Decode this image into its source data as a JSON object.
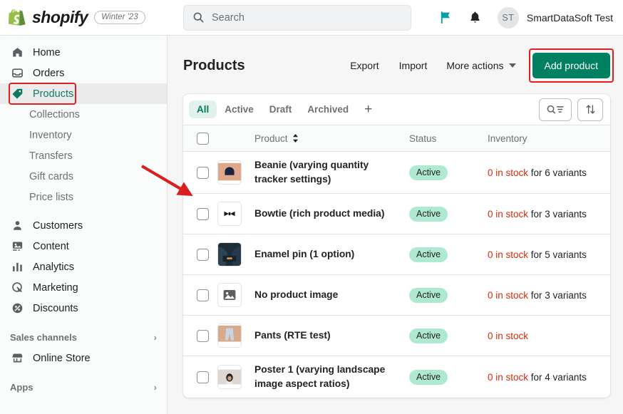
{
  "topbar": {
    "brand_name": "shopify",
    "version_badge": "Winter '23",
    "search_placeholder": "Search",
    "flag_icon": "flag-icon",
    "bell_icon": "bell-icon",
    "avatar_initials": "ST",
    "user_name": "SmartDataSoft Test",
    "accent_teal": "#008fa8"
  },
  "sidebar": {
    "primary": [
      {
        "label": "Home",
        "icon": "home-icon"
      },
      {
        "label": "Orders",
        "icon": "orders-icon"
      },
      {
        "label": "Products",
        "icon": "products-tag-icon",
        "active": true,
        "annotated": true
      }
    ],
    "product_sub": [
      {
        "label": "Collections"
      },
      {
        "label": "Inventory"
      },
      {
        "label": "Transfers"
      },
      {
        "label": "Gift cards"
      },
      {
        "label": "Price lists"
      }
    ],
    "secondary": [
      {
        "label": "Customers",
        "icon": "customers-icon"
      },
      {
        "label": "Content",
        "icon": "content-icon"
      },
      {
        "label": "Analytics",
        "icon": "analytics-icon"
      },
      {
        "label": "Marketing",
        "icon": "marketing-icon"
      },
      {
        "label": "Discounts",
        "icon": "discounts-icon"
      }
    ],
    "sales_channels_label": "Sales channels",
    "online_store_label": "Online Store",
    "apps_label": "Apps",
    "active_color": "#0e7a63"
  },
  "page": {
    "title": "Products",
    "export_label": "Export",
    "import_label": "Import",
    "more_actions_label": "More actions",
    "add_product_label": "Add product",
    "add_button_color": "#008060",
    "annotation_color": "#e02020"
  },
  "tabs": {
    "items": [
      {
        "label": "All",
        "selected": true
      },
      {
        "label": "Active",
        "selected": false
      },
      {
        "label": "Draft",
        "selected": false
      },
      {
        "label": "Archived",
        "selected": false
      }
    ],
    "add_tab_label": "+",
    "search_filter_icon": "search-filter-icon",
    "sort_icon": "sort-arrows-icon"
  },
  "table": {
    "columns": {
      "product": "Product",
      "status": "Status",
      "inventory": "Inventory"
    },
    "rows": [
      {
        "name": "Beanie (varying quantity tracker settings)",
        "status": "Active",
        "inventory_count": "0 in stock",
        "inventory_variants": "for 6 variants",
        "thumb": "beanie-thumbnail"
      },
      {
        "name": "Bowtie (rich product media)",
        "status": "Active",
        "inventory_count": "0 in stock",
        "inventory_variants": "for 3 variants",
        "thumb": "bowtie-thumbnail"
      },
      {
        "name": "Enamel pin (1 option)",
        "status": "Active",
        "inventory_count": "0 in stock",
        "inventory_variants": "for 5 variants",
        "thumb": "enamel-pin-thumbnail"
      },
      {
        "name": "No product image",
        "status": "Active",
        "inventory_count": "0 in stock",
        "inventory_variants": "for 3 variants",
        "thumb": "placeholder-image-icon"
      },
      {
        "name": "Pants (RTE test)",
        "status": "Active",
        "inventory_count": "0 in stock",
        "inventory_variants": "",
        "thumb": "pants-thumbnail"
      },
      {
        "name": "Poster 1 (varying landscape image aspect ratios)",
        "status": "Active",
        "inventory_count": "0 in stock",
        "inventory_variants": "for 4 variants",
        "thumb": "poster-thumbnail"
      }
    ],
    "status_badge_color": "#aee9d1",
    "out_of_stock_color": "#d72c0d"
  }
}
